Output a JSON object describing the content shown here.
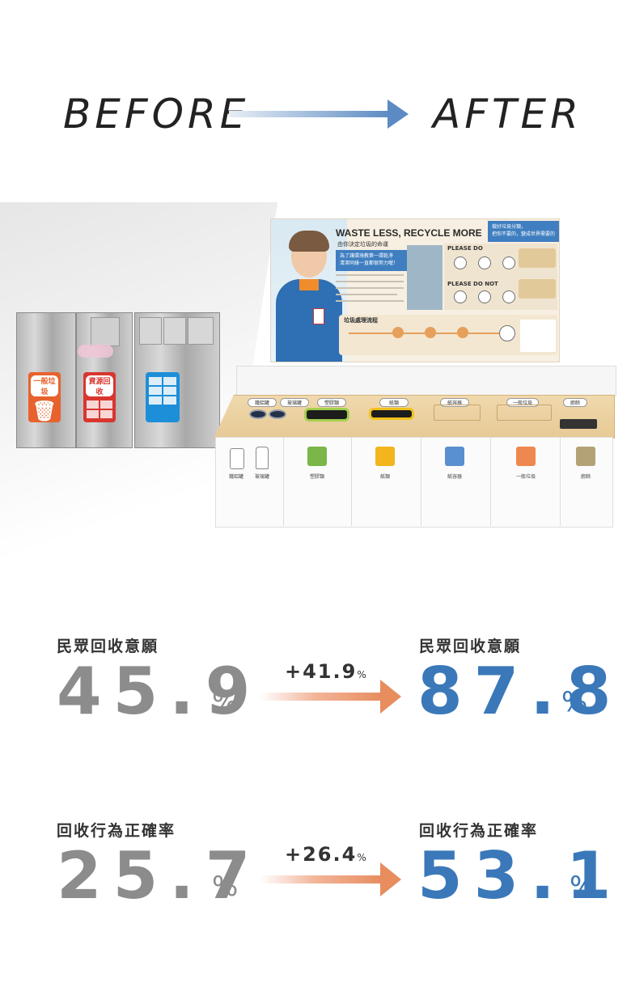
{
  "header": {
    "before": "BEFORE",
    "after": "AFTER"
  },
  "old_bins": {
    "sign_general": "一般垃圾",
    "sign_recycle": "資源回收"
  },
  "poster": {
    "title": "WASTE LESS, RECYCLE MORE",
    "subtitle": "由你決定垃圾的命運",
    "quote": "為了讓環境教第一環乾淨\n清潔同綠一直都很努力喔！",
    "top_right": "做好垃圾分類，\n把你不要的，變成世界需要的",
    "please_do": "PLEASE DO",
    "please_do_not": "PLEASE DO NOT",
    "flow_title": "垃圾處理流程"
  },
  "station": {
    "lid_labels": [
      "鐵鋁罐",
      "玻璃罐",
      "塑膠類",
      "紙類",
      "紙容器",
      "一般垃圾",
      "廚餘"
    ],
    "bins": [
      {
        "label": "鐵鋁罐",
        "color": "#ffffff"
      },
      {
        "label": "玻璃罐",
        "color": "#ffffff"
      },
      {
        "label": "塑膠類",
        "color": "#7ab648"
      },
      {
        "label": "紙類",
        "color": "#f2b51d"
      },
      {
        "label": "紙容器",
        "color": "#5a8fd0"
      },
      {
        "label": "一般垃圾",
        "color": "#ee8850"
      },
      {
        "label": "廚餘",
        "color": "#b3a275"
      }
    ]
  },
  "stats": [
    {
      "label": "民眾回收意願",
      "before": "45.9",
      "delta": "+41.9",
      "after": "87.8",
      "unit": "%"
    },
    {
      "label": "回收行為正確率",
      "before": "25.7",
      "delta": "+26.4",
      "after": "53.1",
      "unit": "%"
    }
  ],
  "colors": {
    "blue": "#3a78b9",
    "gray": "#8c8c8c",
    "orange": "#e78d5e"
  }
}
